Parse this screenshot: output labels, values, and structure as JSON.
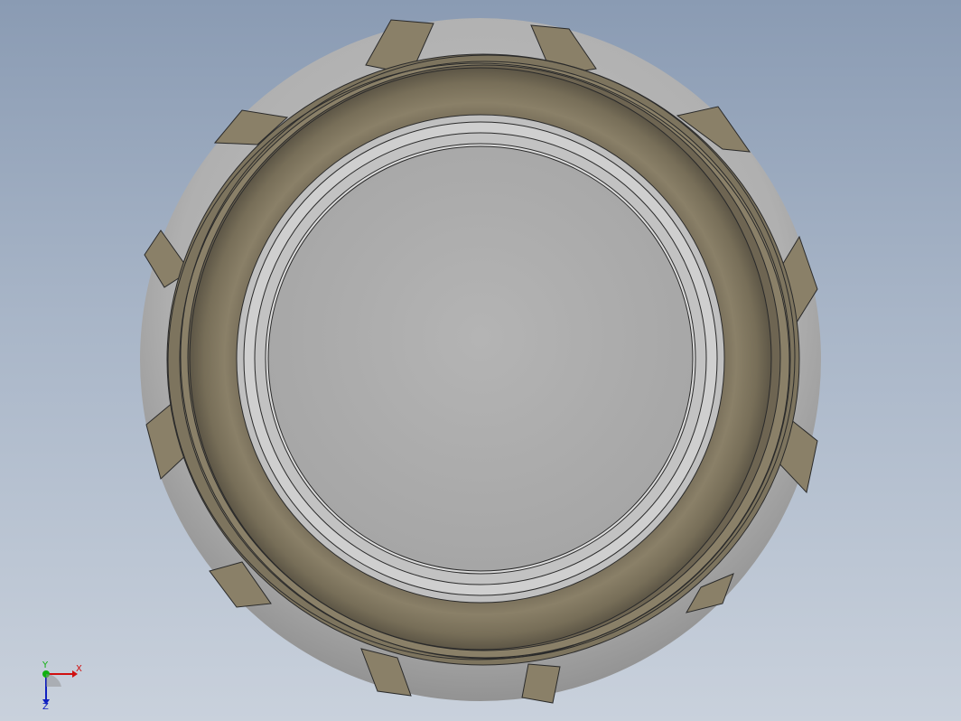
{
  "view": {
    "background_top": "#8a9bb3",
    "background_bottom": "#c9d1dc"
  },
  "model": {
    "part_colors": {
      "body": "#b2b2b2",
      "band": "#8a8068",
      "band_dark": "#6e6552",
      "face": "#aeaeae"
    }
  },
  "triad": {
    "x_label": "X",
    "y_label": "Y",
    "z_label": "Z",
    "x_color": "#d01010",
    "y_color": "#10b010",
    "z_color": "#1020c0"
  }
}
